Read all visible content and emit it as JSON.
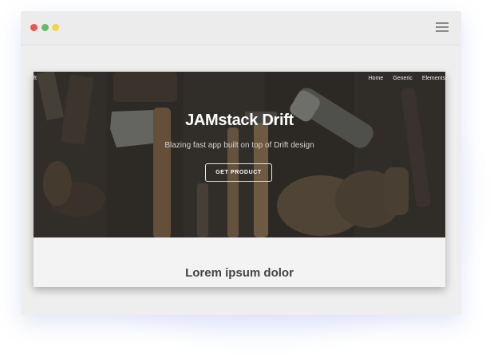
{
  "browser": {
    "controls": [
      "close",
      "minimize",
      "maximize"
    ],
    "menu_icon": "hamburger-icon"
  },
  "site": {
    "nav_left_partial": "ft",
    "nav": [
      "Home",
      "Generic",
      "Elements"
    ],
    "hero": {
      "title": "JAMstack Drift",
      "subtitle": "Blazing fast app built on top of Drift design",
      "button": "GET PRODUCT"
    },
    "section_title": "Lorem ipsum dolor"
  }
}
